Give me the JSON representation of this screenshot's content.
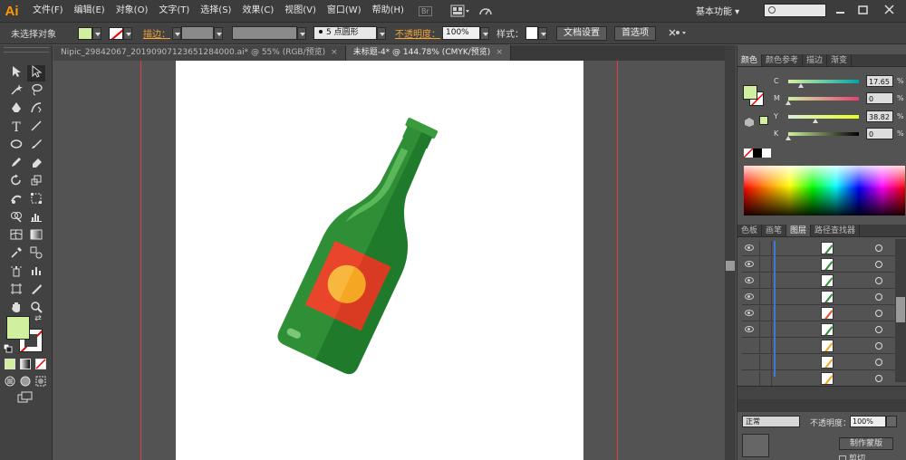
{
  "app": {
    "logo": "Ai",
    "menu": [
      "文件(F)",
      "编辑(E)",
      "对象(O)",
      "文字(T)",
      "选择(S)",
      "效果(C)",
      "视图(V)",
      "窗口(W)",
      "帮助(H)"
    ],
    "bridge_label": "Br",
    "workspace": "基本功能 ▾",
    "search_placeholder": ""
  },
  "control_bar": {
    "selection_label": "未选择对象",
    "stroke_label": "描边：",
    "brush_label": "5 点圆形",
    "opacity_label": "不透明度：",
    "opacity_value": "100%",
    "style_label": "样式：",
    "doc_setup": "文档设置",
    "preferences": "首选项"
  },
  "doc_tabs": [
    {
      "title": "Nipic_29842067_20190907123651284000.ai* @ 55% (RGB/预览)",
      "active": false
    },
    {
      "title": "未标题-4* @ 144.78% (CMYK/预览)",
      "active": true
    }
  ],
  "tab_close": "×",
  "color_panel": {
    "tabs": [
      "颜色",
      "颜色参考",
      "描边",
      "渐变"
    ],
    "channels": [
      {
        "letter": "C",
        "value": "17.65",
        "position": 17.65,
        "colors": [
          "#d8f0a0",
          "#00a5a8"
        ]
      },
      {
        "letter": "M",
        "value": "0",
        "position": 0,
        "colors": [
          "#d0f0a0",
          "#e83f6f"
        ]
      },
      {
        "letter": "Y",
        "value": "38.82",
        "position": 38.82,
        "colors": [
          "#d8f0d8",
          "#e8ff20"
        ]
      },
      {
        "letter": "K",
        "value": "0",
        "position": 0,
        "colors": [
          "#d0f0a0",
          "#000000"
        ]
      }
    ],
    "unit": "%"
  },
  "layers_panel": {
    "tabs": [
      "色板",
      "画笔",
      "图层",
      "路径查找器"
    ],
    "rows": [
      {
        "visible": true,
        "thumb_color": "#2f8f3a"
      },
      {
        "visible": true,
        "thumb_color": "#2f8f3a"
      },
      {
        "visible": true,
        "thumb_color": "#3a9a3a"
      },
      {
        "visible": true,
        "thumb_color": "#2f8f3a"
      },
      {
        "visible": true,
        "thumb_color": "#e8502a"
      },
      {
        "visible": true,
        "thumb_color": "#2f8f3a"
      },
      {
        "visible": false,
        "thumb_color": "#f5a623"
      },
      {
        "visible": false,
        "thumb_color": "#f5a623"
      },
      {
        "visible": false,
        "thumb_color": "#f5a623"
      }
    ]
  },
  "transparency_panel": {
    "mode": "正常",
    "opacity_label": "不透明度：",
    "opacity_value": "100%",
    "make_mask": "制作蒙版",
    "clip": "剪切"
  },
  "colors": {
    "fill": "#d0f0a0",
    "bottle_dark": "#1f7a2c",
    "bottle_main": "#2e8f37",
    "bottle_light": "#4aa84a",
    "label_red": "#e8452a",
    "label_sun": "#f5a623"
  }
}
